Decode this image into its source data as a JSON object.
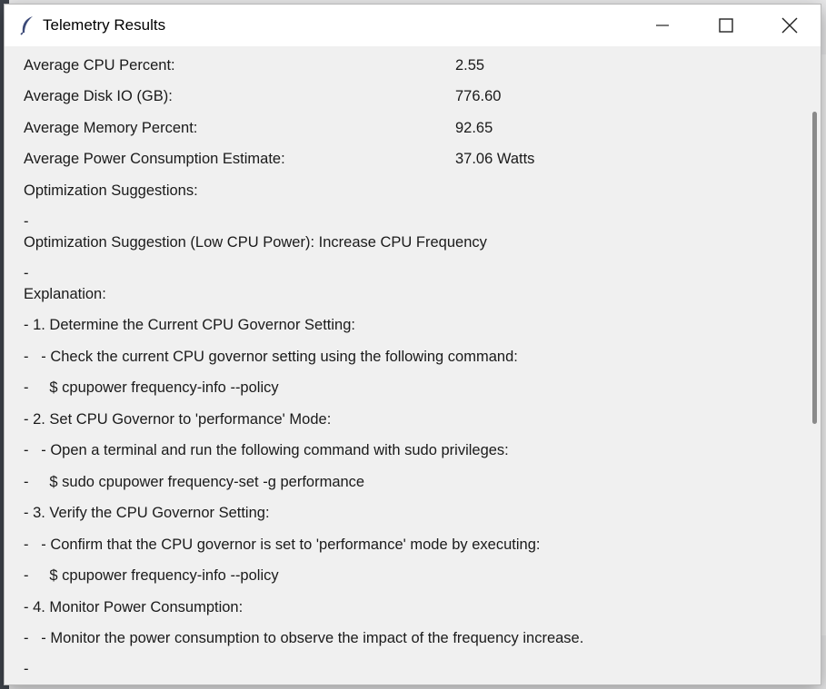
{
  "window": {
    "title": "Telemetry Results"
  },
  "metrics": [
    {
      "label": "Average CPU Percent:",
      "value": "2.55"
    },
    {
      "label": "Average Disk IO (GB):",
      "value": "776.60"
    },
    {
      "label": "Average Memory Percent:",
      "value": "92.65"
    },
    {
      "label": "Average Power Consumption Estimate:",
      "value": "37.06 Watts"
    }
  ],
  "suggestions": {
    "heading": "Optimization Suggestions:",
    "lines": [
      "-",
      "Optimization Suggestion (Low CPU Power): Increase CPU Frequency",
      "-",
      "Explanation:",
      "- 1. Determine the Current CPU Governor Setting:",
      "-   - Check the current CPU governor setting using the following command:",
      "-     $ cpupower frequency-info --policy",
      "- 2. Set CPU Governor to 'performance' Mode:",
      "-   - Open a terminal and run the following command with sudo privileges:",
      "-     $ sudo cpupower frequency-set -g performance",
      "- 3. Verify the CPU Governor Setting:",
      "-   - Confirm that the CPU governor is set to 'performance' mode by executing:",
      "-     $ cpupower frequency-info --policy",
      "- 4. Monitor Power Consumption:",
      "-   - Monitor the power consumption to observe the impact of the frequency increase.",
      "-"
    ]
  },
  "icons": {
    "app": "feather-icon",
    "minimize": "minimize-icon",
    "maximize": "maximize-icon",
    "close": "close-icon"
  }
}
